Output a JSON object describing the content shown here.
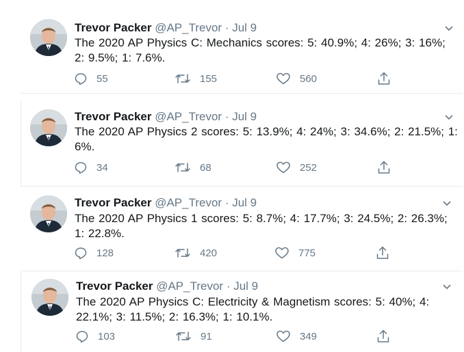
{
  "tweets": [
    {
      "name": "Trevor Packer",
      "handle": "@AP_Trevor",
      "separator": "·",
      "date": "Jul 9",
      "text": "The 2020 AP Physics C: Mechanics scores:  5: 40.9%;  4: 26%;  3: 16%;  2: 9.5%;  1: 7.6%.",
      "replies": "55",
      "retweets": "155",
      "likes": "560"
    },
    {
      "name": "Trevor Packer",
      "handle": "@AP_Trevor",
      "separator": "·",
      "date": "Jul 9",
      "text": "The 2020 AP Physics 2 scores:  5: 13.9%;  4: 24%;  3: 34.6%;  2: 21.5%;  1: 6%.",
      "replies": "34",
      "retweets": "68",
      "likes": "252"
    },
    {
      "name": "Trevor Packer",
      "handle": "@AP_Trevor",
      "separator": "·",
      "date": "Jul 9",
      "text": "The 2020 AP Physics 1 scores:  5: 8.7%;  4: 17.7%;  3: 24.5%;  2: 26.3%;  1: 22.8%.",
      "replies": "128",
      "retweets": "420",
      "likes": "775"
    },
    {
      "name": "Trevor Packer",
      "handle": "@AP_Trevor",
      "separator": "·",
      "date": "Jul 9",
      "text": "The 2020 AP Physics C: Electricity & Magnetism scores:  5: 40%;  4: 22.1%;  3: 11.5%;  2: 16.3%;  1: 10.1%.",
      "replies": "103",
      "retweets": "91",
      "likes": "349"
    }
  ],
  "icons": {
    "reply": "reply-icon",
    "retweet": "retweet-icon",
    "like": "heart-icon",
    "share": "share-icon",
    "caret": "chevron-down-icon"
  },
  "colors": {
    "text": "#14171a",
    "secondary": "#657786",
    "divider": "#e6ecf0"
  }
}
